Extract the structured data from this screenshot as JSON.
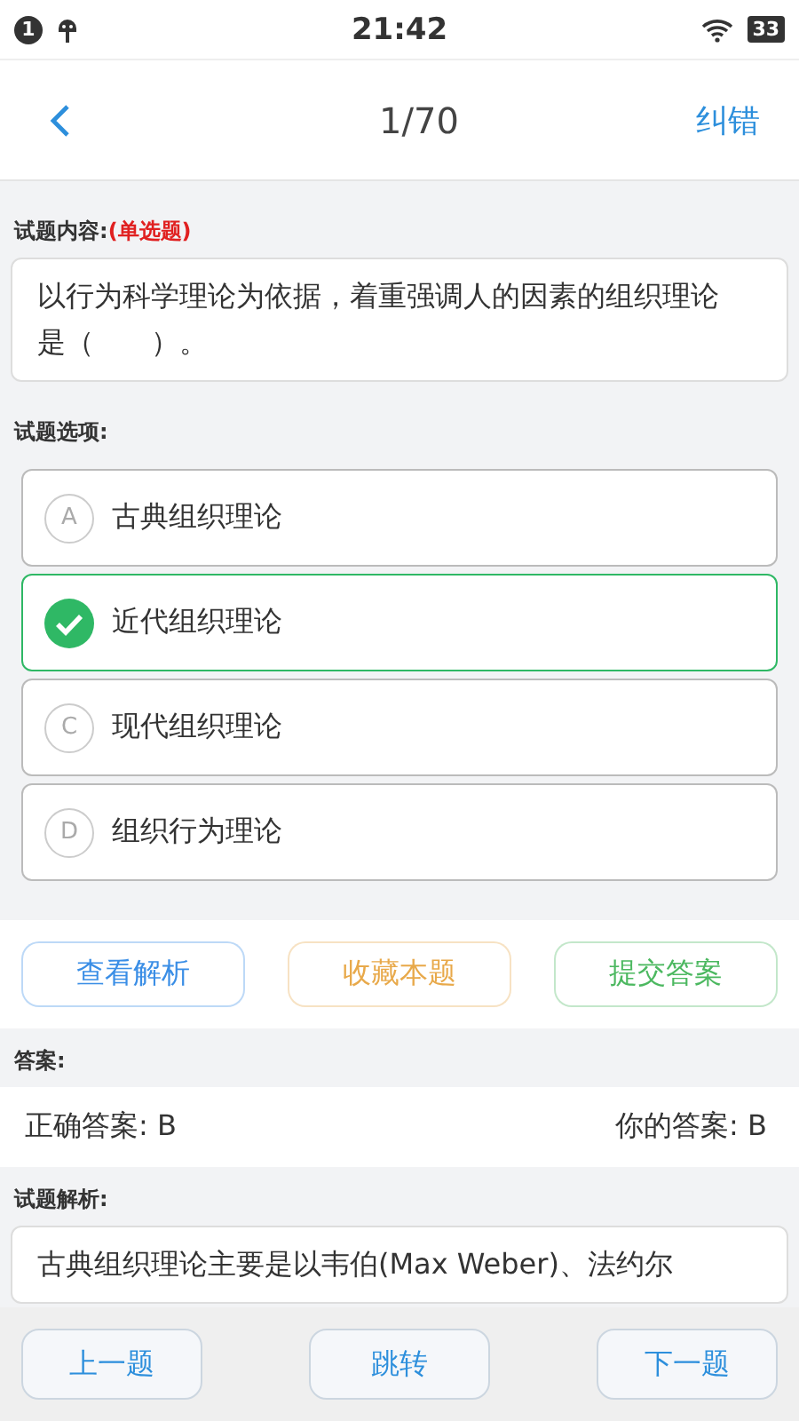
{
  "status_bar": {
    "notification_count": "1",
    "time": "21:42",
    "battery": "33"
  },
  "nav": {
    "counter": "1/70",
    "action": "纠错"
  },
  "question": {
    "label": "试题内容:",
    "type": "(单选题)",
    "text": "以行为科学理论为依据，着重强调人的因素的组织理论是（　　）。"
  },
  "options_label": "试题选项:",
  "options": [
    {
      "letter": "A",
      "text": "古典组织理论",
      "selected": false
    },
    {
      "text": "近代组织理论",
      "selected": true
    },
    {
      "letter": "C",
      "text": "现代组织理论",
      "selected": false
    },
    {
      "letter": "D",
      "text": "组织行为理论",
      "selected": false
    }
  ],
  "actions": [
    {
      "label": "查看解析",
      "color": "#3a8ee6"
    },
    {
      "label": "收藏本题",
      "color": "#e8a94a"
    },
    {
      "label": "提交答案",
      "color": "#4cb860"
    }
  ],
  "answer": {
    "label": "答案:",
    "correct": "正确答案: B",
    "yours": "你的答案: B"
  },
  "analysis": {
    "label": "试题解析:",
    "text": "古典组织理论主要是以韦伯(Max Weber)、法约尔"
  },
  "bottom_buttons": [
    "上一题",
    "跳转",
    "下一题"
  ]
}
